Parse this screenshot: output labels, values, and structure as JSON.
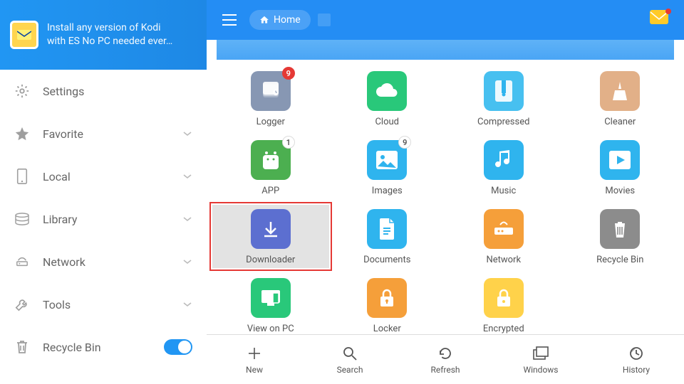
{
  "banner": {
    "line1": "Install any version of Kodi",
    "line2": "with ES No PC needed ever…"
  },
  "sidebar": {
    "items": [
      {
        "label": "Settings",
        "expandable": false
      },
      {
        "label": "Favorite",
        "expandable": true
      },
      {
        "label": "Local",
        "expandable": true
      },
      {
        "label": "Library",
        "expandable": true
      },
      {
        "label": "Network",
        "expandable": true
      },
      {
        "label": "Tools",
        "expandable": true
      },
      {
        "label": "Recycle Bin",
        "expandable": false,
        "toggle": true
      }
    ]
  },
  "topbar": {
    "home_label": "Home"
  },
  "tiles": [
    {
      "label": "Logger",
      "badge": "9",
      "badge_style": "red",
      "bg": "#8797b3"
    },
    {
      "label": "Cloud",
      "bg": "#29c87a"
    },
    {
      "label": "Compressed",
      "bg": "#47c0f0"
    },
    {
      "label": "Cleaner",
      "bg": "#e2b088"
    },
    {
      "label": "APP",
      "badge": "1",
      "badge_style": "white",
      "bg": "#4caf50"
    },
    {
      "label": "Images",
      "badge": "9",
      "badge_style": "white",
      "bg": "#2fb4ee"
    },
    {
      "label": "Music",
      "bg": "#2fb4ee"
    },
    {
      "label": "Movies",
      "bg": "#2fb4ee"
    },
    {
      "label": "Downloader",
      "bg": "#5c6fd0",
      "selected": true
    },
    {
      "label": "Documents",
      "bg": "#2fb4ee"
    },
    {
      "label": "Network",
      "bg": "#f59f3a"
    },
    {
      "label": "Recycle Bin",
      "bg": "#8c8c8c"
    },
    {
      "label": "View on PC",
      "bg": "#29c87a"
    },
    {
      "label": "Locker",
      "bg": "#f59f3a"
    },
    {
      "label": "Encrypted",
      "bg": "#ffd24a"
    }
  ],
  "bottombar": {
    "items": [
      {
        "label": "New"
      },
      {
        "label": "Search"
      },
      {
        "label": "Refresh"
      },
      {
        "label": "Windows"
      },
      {
        "label": "History"
      }
    ]
  }
}
